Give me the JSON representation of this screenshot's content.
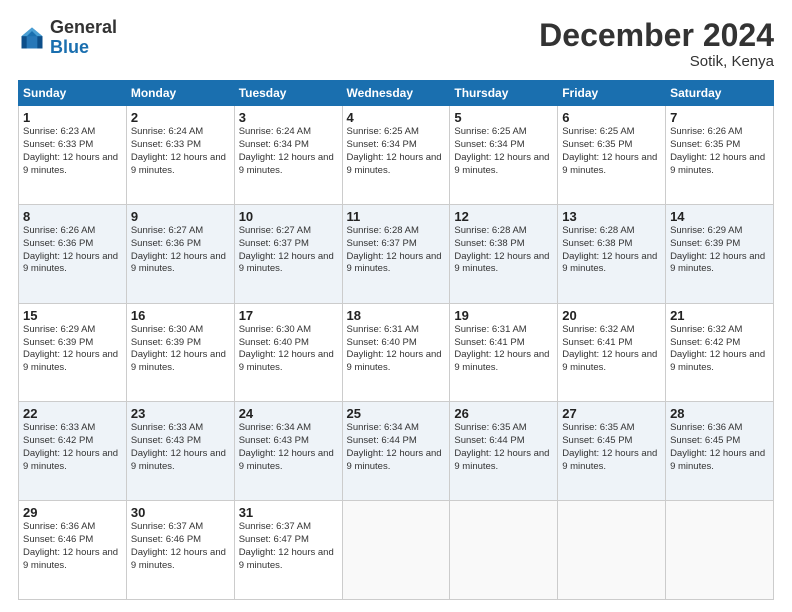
{
  "header": {
    "logo": {
      "general": "General",
      "blue": "Blue"
    },
    "title": "December 2024",
    "location": "Sotik, Kenya"
  },
  "days_of_week": [
    "Sunday",
    "Monday",
    "Tuesday",
    "Wednesday",
    "Thursday",
    "Friday",
    "Saturday"
  ],
  "weeks": [
    [
      {
        "day": "1",
        "sunrise": "6:23 AM",
        "sunset": "6:33 PM",
        "daylight": "12 hours and 9 minutes."
      },
      {
        "day": "2",
        "sunrise": "6:24 AM",
        "sunset": "6:33 PM",
        "daylight": "12 hours and 9 minutes."
      },
      {
        "day": "3",
        "sunrise": "6:24 AM",
        "sunset": "6:34 PM",
        "daylight": "12 hours and 9 minutes."
      },
      {
        "day": "4",
        "sunrise": "6:25 AM",
        "sunset": "6:34 PM",
        "daylight": "12 hours and 9 minutes."
      },
      {
        "day": "5",
        "sunrise": "6:25 AM",
        "sunset": "6:34 PM",
        "daylight": "12 hours and 9 minutes."
      },
      {
        "day": "6",
        "sunrise": "6:25 AM",
        "sunset": "6:35 PM",
        "daylight": "12 hours and 9 minutes."
      },
      {
        "day": "7",
        "sunrise": "6:26 AM",
        "sunset": "6:35 PM",
        "daylight": "12 hours and 9 minutes."
      }
    ],
    [
      {
        "day": "8",
        "sunrise": "6:26 AM",
        "sunset": "6:36 PM",
        "daylight": "12 hours and 9 minutes."
      },
      {
        "day": "9",
        "sunrise": "6:27 AM",
        "sunset": "6:36 PM",
        "daylight": "12 hours and 9 minutes."
      },
      {
        "day": "10",
        "sunrise": "6:27 AM",
        "sunset": "6:37 PM",
        "daylight": "12 hours and 9 minutes."
      },
      {
        "day": "11",
        "sunrise": "6:28 AM",
        "sunset": "6:37 PM",
        "daylight": "12 hours and 9 minutes."
      },
      {
        "day": "12",
        "sunrise": "6:28 AM",
        "sunset": "6:38 PM",
        "daylight": "12 hours and 9 minutes."
      },
      {
        "day": "13",
        "sunrise": "6:28 AM",
        "sunset": "6:38 PM",
        "daylight": "12 hours and 9 minutes."
      },
      {
        "day": "14",
        "sunrise": "6:29 AM",
        "sunset": "6:39 PM",
        "daylight": "12 hours and 9 minutes."
      }
    ],
    [
      {
        "day": "15",
        "sunrise": "6:29 AM",
        "sunset": "6:39 PM",
        "daylight": "12 hours and 9 minutes."
      },
      {
        "day": "16",
        "sunrise": "6:30 AM",
        "sunset": "6:39 PM",
        "daylight": "12 hours and 9 minutes."
      },
      {
        "day": "17",
        "sunrise": "6:30 AM",
        "sunset": "6:40 PM",
        "daylight": "12 hours and 9 minutes."
      },
      {
        "day": "18",
        "sunrise": "6:31 AM",
        "sunset": "6:40 PM",
        "daylight": "12 hours and 9 minutes."
      },
      {
        "day": "19",
        "sunrise": "6:31 AM",
        "sunset": "6:41 PM",
        "daylight": "12 hours and 9 minutes."
      },
      {
        "day": "20",
        "sunrise": "6:32 AM",
        "sunset": "6:41 PM",
        "daylight": "12 hours and 9 minutes."
      },
      {
        "day": "21",
        "sunrise": "6:32 AM",
        "sunset": "6:42 PM",
        "daylight": "12 hours and 9 minutes."
      }
    ],
    [
      {
        "day": "22",
        "sunrise": "6:33 AM",
        "sunset": "6:42 PM",
        "daylight": "12 hours and 9 minutes."
      },
      {
        "day": "23",
        "sunrise": "6:33 AM",
        "sunset": "6:43 PM",
        "daylight": "12 hours and 9 minutes."
      },
      {
        "day": "24",
        "sunrise": "6:34 AM",
        "sunset": "6:43 PM",
        "daylight": "12 hours and 9 minutes."
      },
      {
        "day": "25",
        "sunrise": "6:34 AM",
        "sunset": "6:44 PM",
        "daylight": "12 hours and 9 minutes."
      },
      {
        "day": "26",
        "sunrise": "6:35 AM",
        "sunset": "6:44 PM",
        "daylight": "12 hours and 9 minutes."
      },
      {
        "day": "27",
        "sunrise": "6:35 AM",
        "sunset": "6:45 PM",
        "daylight": "12 hours and 9 minutes."
      },
      {
        "day": "28",
        "sunrise": "6:36 AM",
        "sunset": "6:45 PM",
        "daylight": "12 hours and 9 minutes."
      }
    ],
    [
      {
        "day": "29",
        "sunrise": "6:36 AM",
        "sunset": "6:46 PM",
        "daylight": "12 hours and 9 minutes."
      },
      {
        "day": "30",
        "sunrise": "6:37 AM",
        "sunset": "6:46 PM",
        "daylight": "12 hours and 9 minutes."
      },
      {
        "day": "31",
        "sunrise": "6:37 AM",
        "sunset": "6:47 PM",
        "daylight": "12 hours and 9 minutes."
      },
      null,
      null,
      null,
      null
    ]
  ],
  "labels": {
    "sunrise_prefix": "Sunrise: ",
    "sunset_prefix": "Sunset: ",
    "daylight_prefix": "Daylight: "
  }
}
